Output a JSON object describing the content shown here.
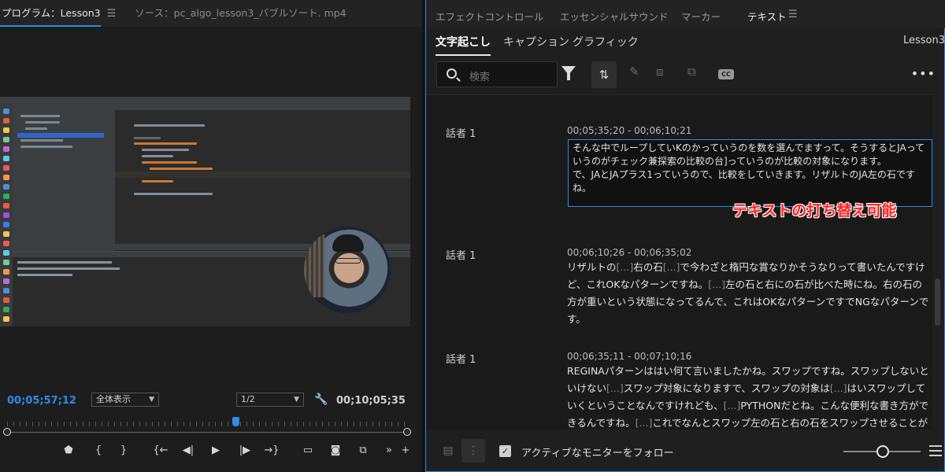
{
  "program": {
    "tabs": [
      {
        "label": "プログラム：Lesson3",
        "active": true
      },
      {
        "label": "ソース：pc_algo_lesson3_バブルソート. mp4",
        "active": false
      }
    ],
    "menu_icon": "hamburger-menu-icon",
    "current_timecode": "00;05;57;12",
    "view_select": "全体表示",
    "resolution_select": "1/2",
    "duration": "00;10;05;35",
    "playhead_fraction": 0.57
  },
  "panel": {
    "tabs": [
      {
        "label": "エフェクトコントロール",
        "active": false
      },
      {
        "label": "エッセンシャルサウンド",
        "active": false
      },
      {
        "label": "マーカー",
        "active": false
      },
      {
        "label": "テキスト",
        "active": true
      }
    ],
    "subtabs": [
      {
        "label": "文字起こし",
        "active": true
      },
      {
        "label": "キャプション",
        "active": false
      },
      {
        "label": "グラフィック",
        "active": false
      }
    ],
    "sequence_name": "Lesson3",
    "search": {
      "placeholder": "検索"
    },
    "follow_monitor": {
      "checked": true,
      "label": "アクティブなモニターをフォロー"
    },
    "accent": "#2d8ceb",
    "callout": "テキストの打ち替え可能"
  },
  "transcript": [
    {
      "speaker": "話者 1",
      "timerange": "00;05;35;20 - 00;06;10;21",
      "text": "そんな中でループしていKのかっていうのを数を選んでますって。そうするとJAっていうのがチェック兼探索の比較の台]っていうのが比較の対象になります。\nで、JAとJAプラス1っていうので、比較をしていきます。リザルトのJA左の石ですね。",
      "editing": true
    },
    {
      "speaker": "話者 1",
      "timerange": "00;06;10;26 - 00;06;35;02",
      "text": "リザルトの[...]右の石[...]で今わざと楕円な賞なりかそうなりって書いたんですけど、これOKなパターンですね。[...]左の石と右にの石が比べた時にね。右の石の方が重いという状態になってるんで、これはOKなパターンですでNGなパターンです。"
    },
    {
      "speaker": "話者 1",
      "timerange": "00;06;35;11 - 00;07;10;16",
      "text": "REGINAパターンははい何て言いましたかね。スワップですね。スワップしないといけない[...]スワップ対象になりますで、スワップの対象は[...]はいスワップしていくということなんですけれども、[...]PYTHONだとね。こんな便利な書き方ができるんですね。[...]これでなんとスワップ左の石と右の石をスワップさせることができるで、カンマとイコールで繋"
    }
  ]
}
